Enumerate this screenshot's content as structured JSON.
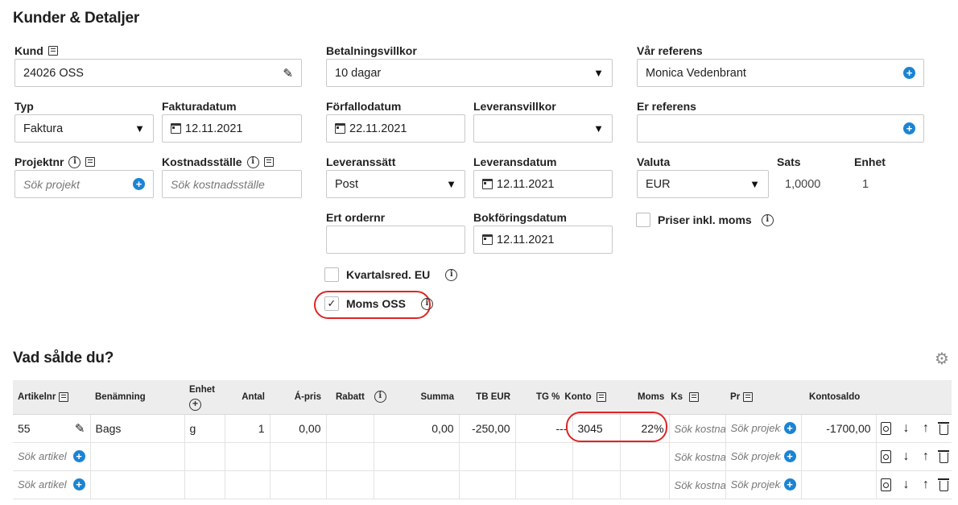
{
  "section_title": "Kunder & Detaljer",
  "kund": {
    "label": "Kund",
    "value": "24026 OSS"
  },
  "typ": {
    "label": "Typ",
    "value": "Faktura"
  },
  "fakturadatum": {
    "label": "Fakturadatum",
    "value": "12.11.2021"
  },
  "projektnr": {
    "label": "Projektnr",
    "placeholder": "Sök projekt"
  },
  "kostnadsstalle": {
    "label": "Kostnadsställe",
    "placeholder": "Sök kostnadsställe"
  },
  "betalningsvillkor": {
    "label": "Betalningsvillkor",
    "value": "10 dagar"
  },
  "forfallodatum": {
    "label": "Förfallodatum",
    "value": "22.11.2021"
  },
  "leveransvillkor": {
    "label": "Leveransvillkor",
    "value": ""
  },
  "leveranssatt": {
    "label": "Leveranssätt",
    "value": "Post"
  },
  "leveransdatum": {
    "label": "Leveransdatum",
    "value": "12.11.2021"
  },
  "ert_ordernr": {
    "label": "Ert ordernr",
    "value": ""
  },
  "bokforingsdatum": {
    "label": "Bokföringsdatum",
    "value": "12.11.2021"
  },
  "kvartalsred": {
    "label": "Kvartalsred. EU",
    "checked": false
  },
  "moms_oss": {
    "label": "Moms OSS",
    "checked": true,
    "check_glyph": "✓"
  },
  "var_referens": {
    "label": "Vår referens",
    "value": "Monica Vedenbrant"
  },
  "er_referens": {
    "label": "Er referens",
    "value": ""
  },
  "valuta": {
    "label": "Valuta",
    "value": "EUR"
  },
  "sats": {
    "label": "Sats",
    "value": "1,0000"
  },
  "enhet": {
    "label": "Enhet",
    "value": "1"
  },
  "priser_inkl_moms": {
    "label": "Priser inkl. moms",
    "checked": false
  },
  "items_title": "Vad sålde du?",
  "table": {
    "headers": {
      "artikelnr": "Artikelnr",
      "benamning": "Benämning",
      "enhet": "Enhet",
      "antal": "Antal",
      "apris": "Á-pris",
      "rabatt": "Rabatt",
      "summa": "Summa",
      "tb": "TB EUR",
      "tg": "TG %",
      "konto": "Konto",
      "moms": "Moms",
      "ks": "Ks",
      "pr": "Pr",
      "kontosaldo": "Kontosaldo"
    },
    "rows": [
      {
        "artikelnr": "55",
        "benamning": "Bags",
        "enhet": "g",
        "antal": "1",
        "apris": "0,00",
        "rabatt": "",
        "summa": "0,00",
        "tb": "-250,00",
        "tg": "---",
        "konto": "3045",
        "moms": "22%",
        "ks_placeholder": "Sök kostnadsställe",
        "pr_placeholder": "Sök projekt",
        "kontosaldo": "-1700,00"
      }
    ],
    "empty_row_placeholders": {
      "artikel": "Sök artikel",
      "ks": "Sök kostnadsställe",
      "pr": "Sök projekt"
    }
  },
  "icons": {
    "accent": "#1a84d4",
    "highlight": "#e02424",
    "edit": "pencil-icon",
    "settings": "gear-icon",
    "preview": "document-search-icon",
    "move_down": "arrow-down-icon",
    "move_up": "arrow-up-icon",
    "delete": "trash-icon"
  }
}
